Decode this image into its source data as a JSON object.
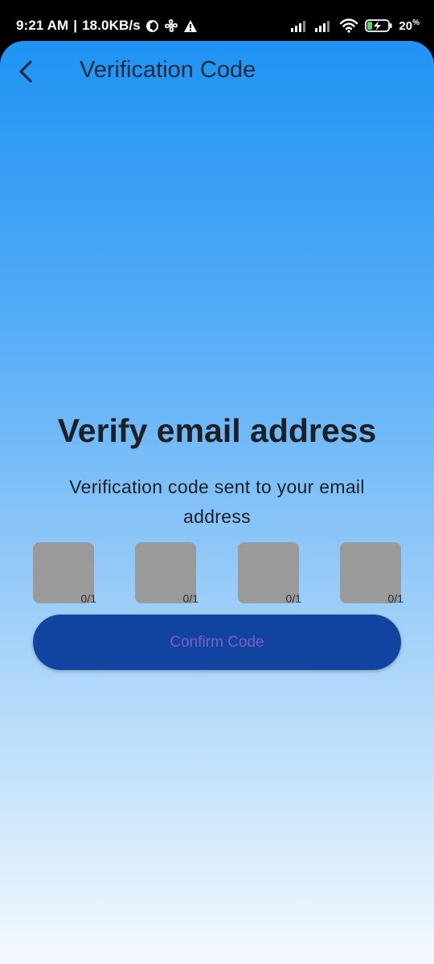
{
  "status_bar": {
    "time": "9:21 AM",
    "separator": "|",
    "speed": "18.0KB/s",
    "battery_level": "20",
    "battery_unit": "%",
    "icons": [
      "app-notification-icon",
      "fan-icon",
      "warning-icon",
      "signal-icon",
      "signal-icon",
      "wifi-icon",
      "battery-charging-icon"
    ]
  },
  "appbar": {
    "title": "Verification Code",
    "back_icon": "chevron-left-icon"
  },
  "main": {
    "heading": "Verify email address",
    "subtitle": "Verification code sent to your email address",
    "code_boxes": [
      {
        "value": "",
        "counter": "0/1"
      },
      {
        "value": "",
        "counter": "0/1"
      },
      {
        "value": "",
        "counter": "0/1"
      },
      {
        "value": "",
        "counter": "0/1"
      }
    ],
    "confirm_label": "Confirm Code"
  },
  "colors": {
    "gradient_top": "#1f93f3",
    "gradient_bottom": "#f5f9fe",
    "code_box": "#9a9a9a",
    "button_bg": "#1144a0",
    "button_text": "#7e5fc0"
  }
}
